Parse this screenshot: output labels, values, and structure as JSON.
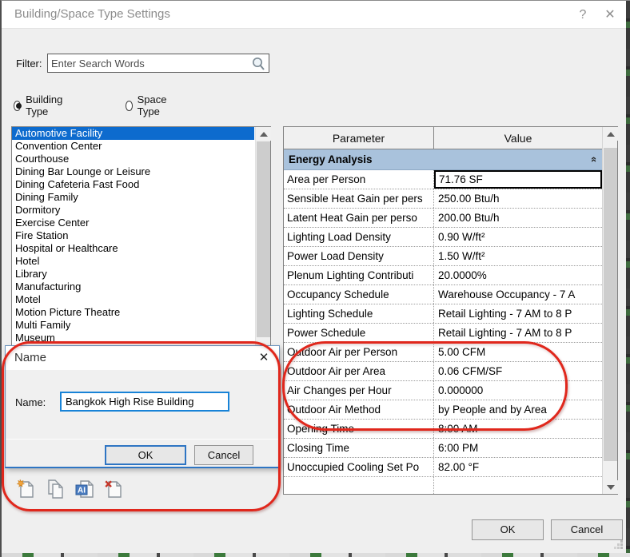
{
  "window": {
    "title": "Building/Space Type Settings",
    "help": "?",
    "close": "✕"
  },
  "filter": {
    "label": "Filter:",
    "placeholder": "Enter Search Words"
  },
  "radios": {
    "building_type": "Building Type",
    "space_type": "Space Type",
    "selected": "Building Type"
  },
  "type_list": {
    "selected_index": 0,
    "items": [
      "Automotive Facility",
      "Convention Center",
      "Courthouse",
      "Dining Bar Lounge or Leisure",
      "Dining Cafeteria Fast Food",
      "Dining Family",
      "Dormitory",
      "Exercise Center",
      "Fire Station",
      "Hospital or Healthcare",
      "Hotel",
      "Library",
      "Manufacturing",
      "Motel",
      "Motion Picture Theatre",
      "Multi Family",
      "Museum"
    ]
  },
  "table": {
    "columns": [
      "Parameter",
      "Value"
    ],
    "group": "Energy Analysis",
    "rows": [
      {
        "param": "Area per Person",
        "value": "71.76 SF",
        "selected": true
      },
      {
        "param": "Sensible Heat Gain per pers",
        "value": "250.00 Btu/h"
      },
      {
        "param": "Latent Heat Gain per perso",
        "value": "200.00 Btu/h"
      },
      {
        "param": "Lighting Load Density",
        "value": "0.90 W/ft²"
      },
      {
        "param": "Power Load Density",
        "value": "1.50 W/ft²"
      },
      {
        "param": "Plenum Lighting Contributi",
        "value": "20.0000%"
      },
      {
        "param": "Occupancy Schedule",
        "value": "Warehouse Occupancy - 7 A"
      },
      {
        "param": "Lighting Schedule",
        "value": "Retail Lighting - 7 AM to 8 P"
      },
      {
        "param": "Power Schedule",
        "value": "Retail Lighting - 7 AM to 8 P"
      },
      {
        "param": "Outdoor Air per Person",
        "value": "5.00 CFM"
      },
      {
        "param": "Outdoor Air per Area",
        "value": "0.06 CFM/SF"
      },
      {
        "param": "Air Changes per Hour",
        "value": "0.000000"
      },
      {
        "param": "Outdoor Air Method",
        "value": "by People and by Area"
      },
      {
        "param": "Opening Time",
        "value": "8:00 AM"
      },
      {
        "param": "Closing Time",
        "value": "6:00 PM"
      },
      {
        "param": "Unoccupied Cooling Set Po",
        "value": "82.00 °F"
      }
    ]
  },
  "name_dialog": {
    "title": "Name",
    "close": "✕",
    "label": "Name:",
    "value": "Bangkok High Rise Building",
    "ok": "OK",
    "cancel": "Cancel"
  },
  "toolbar_icons": [
    "new-type-icon",
    "duplicate-type-icon",
    "rename-type-icon",
    "delete-type-icon"
  ],
  "footer": {
    "ok": "OK",
    "cancel": "Cancel"
  },
  "colors": {
    "selection_blue": "#0d6bce",
    "group_header_blue": "#a9c2dc",
    "focus_border_blue": "#2e75c3",
    "annotation_red": "#e0271c"
  }
}
